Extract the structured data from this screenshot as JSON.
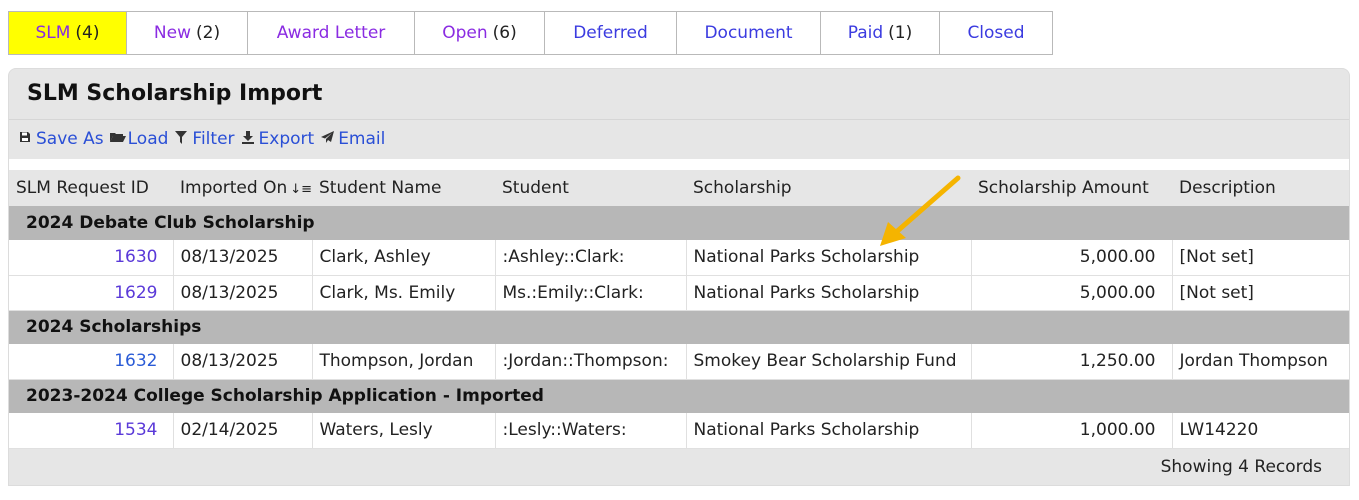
{
  "tabs": [
    {
      "label": "SLM",
      "count": "(4)"
    },
    {
      "label": "New",
      "count": "(2)"
    },
    {
      "label": "Award Letter",
      "count": ""
    },
    {
      "label": "Open",
      "count": "(6)"
    },
    {
      "label": "Deferred",
      "count": ""
    },
    {
      "label": "Document",
      "count": ""
    },
    {
      "label": "Paid",
      "count": "(1)"
    },
    {
      "label": "Closed",
      "count": ""
    }
  ],
  "panel": {
    "title": "SLM Scholarship Import",
    "toolbar": {
      "save_as": "Save As",
      "load": "Load",
      "filter": "Filter",
      "export": "Export",
      "email": "Email"
    }
  },
  "table": {
    "columns": [
      "SLM Request ID",
      "Imported On",
      "Student Name",
      "Student",
      "Scholarship",
      "Scholarship Amount",
      "Description"
    ],
    "groups": [
      {
        "name": "2024 Debate Club Scholarship",
        "rows": [
          [
            "1630",
            "08/13/2025",
            "Clark, Ashley",
            ":Ashley::Clark:",
            "National Parks Scholarship",
            "5,000.00",
            "[Not set]"
          ],
          [
            "1629",
            "08/13/2025",
            "Clark, Ms. Emily",
            "Ms.:Emily::Clark:",
            "National Parks Scholarship",
            "5,000.00",
            "[Not set]"
          ]
        ]
      },
      {
        "name": "2024 Scholarships",
        "rows": [
          [
            "1632",
            "08/13/2025",
            "Thompson, Jordan",
            ":Jordan::Thompson:",
            "Smokey Bear Scholarship Fund",
            "1,250.00",
            "Jordan Thompson"
          ]
        ]
      },
      {
        "name": "2023-2024 College Scholarship Application - Imported",
        "rows": [
          [
            "1534",
            "02/14/2025",
            "Waters, Lesly",
            ":Lesly::Waters:",
            "National Parks Scholarship",
            "1,000.00",
            "LW14220"
          ]
        ]
      }
    ]
  },
  "footer": "Showing 4 Records",
  "colors": {
    "active_tab": "#ffff00",
    "link_blue": "#2a4fd6",
    "link_purple": "#8a2be2",
    "group_row": "#b7b7b7",
    "arrow": "#f5b400"
  },
  "icons": [
    "save-icon",
    "folder-open-icon",
    "filter-icon",
    "export-icon",
    "email-icon",
    "sort-desc-icon"
  ]
}
